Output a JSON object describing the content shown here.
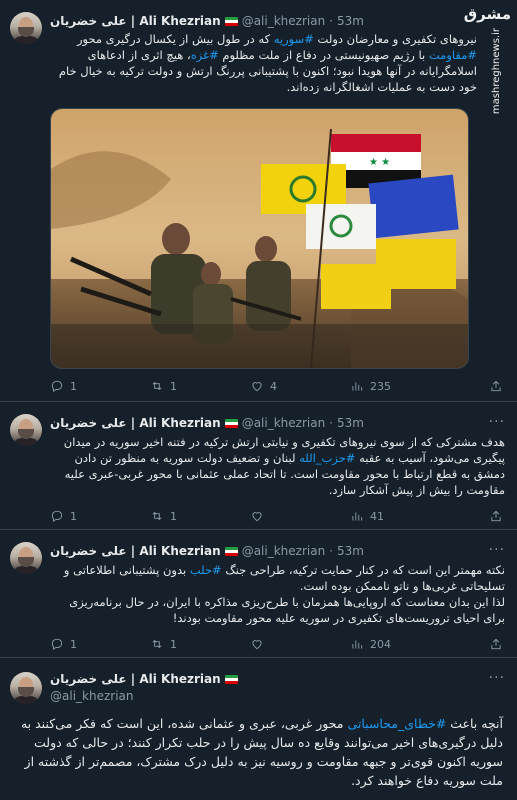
{
  "watermark": {
    "logo": "مشرق",
    "url": "mashreghnews.ir"
  },
  "author": {
    "name": "علی خضریان | Ali Khezrian",
    "handle": "@ali_khezrian"
  },
  "tweets": [
    {
      "time": "53m",
      "text_parts": [
        {
          "t": "نیروهای تکفیری و معارضان دولت "
        },
        {
          "t": "#سوریه",
          "tag": true
        },
        {
          "t": " که در طول بیش از یکسال درگیری محور "
        },
        {
          "t": "#مقاومت",
          "tag": true
        },
        {
          "t": " با رژیم صهیونیستی در دفاع از ملت مظلوم "
        },
        {
          "t": "#غزه",
          "tag": true
        },
        {
          "t": "، هیچ اثری از ادعاهای اسلامگرایانه در آنها هویدا نبود؛ اکنون با پشتیبانی پررنگ ارتش و دولت ترکیه به خیال خام خود دست به عملیات اشغالگرانه زده‌اند."
        }
      ],
      "replies": "1",
      "retweets": "1",
      "likes": "4",
      "views": "235"
    },
    {
      "time": "53m",
      "text_parts": [
        {
          "t": "هدف مشترکی که از سوی نیروهای تکفیری و نیابتی ارتش ترکیه در فتنه اخیر سوریه در میدان پیگیری می‌شود، آسیب به عقبه "
        },
        {
          "t": "#حزب_الله",
          "tag": true
        },
        {
          "t": " لبنان و تضعیف دولت سوریه به منظور تن دادن دمشق به قطع ارتباط با محور مقاومت است. تا اتحاد عملی عثمانی با محور غربی-عبری علیه مقاومت را بیش از پیش آشکار سازد."
        }
      ],
      "replies": "1",
      "retweets": "1",
      "likes": "",
      "views": "41"
    },
    {
      "time": "53m",
      "text_parts": [
        {
          "t": "نکته مهمتر این است که در کنار حمایت ترکیه، طراحی جنگ "
        },
        {
          "t": "#حلب",
          "tag": true
        },
        {
          "t": " بدون پشتیبانی اطلاعاتی و تسلیحاتی غربی‌ها و ناتو ناممکن بوده است."
        },
        {
          "br": true
        },
        {
          "t": "لذا این بدان معناست که اروپایی‌ها همزمان با طرح‌ریزی مذاکره با ایران، در حال برنامه‌ریزی برای احیای تروریست‌های تکفیری در سوریه علیه محور مقاومت بودند!"
        }
      ],
      "replies": "1",
      "retweets": "1",
      "likes": "",
      "views": "204"
    },
    {
      "time": "",
      "text_parts": [
        {
          "t": "آنچه باعث "
        },
        {
          "t": "#خطای_محاسباتی",
          "tag": true
        },
        {
          "t": " محور غربی، عبری و عثمانی شده، این است که فکر می‌کنند به دلیل درگیری‌های اخیر می‌توانند وقایع ده سال پیش را در حلب تکرار کنند؛ در حالی که دولت سوریه اکنون قوی‌تر و جبهه مقاومت و روسیه نیز به دلیل درک مشترک، مصمم‌تر از گذشته از ملت سوریه دفاع خواهند کرد."
        }
      ]
    }
  ],
  "colors": {
    "background": "#15202b",
    "accent": "#1d9bf0",
    "muted": "#8b98a5",
    "border": "#38444d"
  },
  "icons": [
    "reply-icon",
    "retweet-icon",
    "like-icon",
    "views-icon",
    "share-icon",
    "more-icon"
  ]
}
